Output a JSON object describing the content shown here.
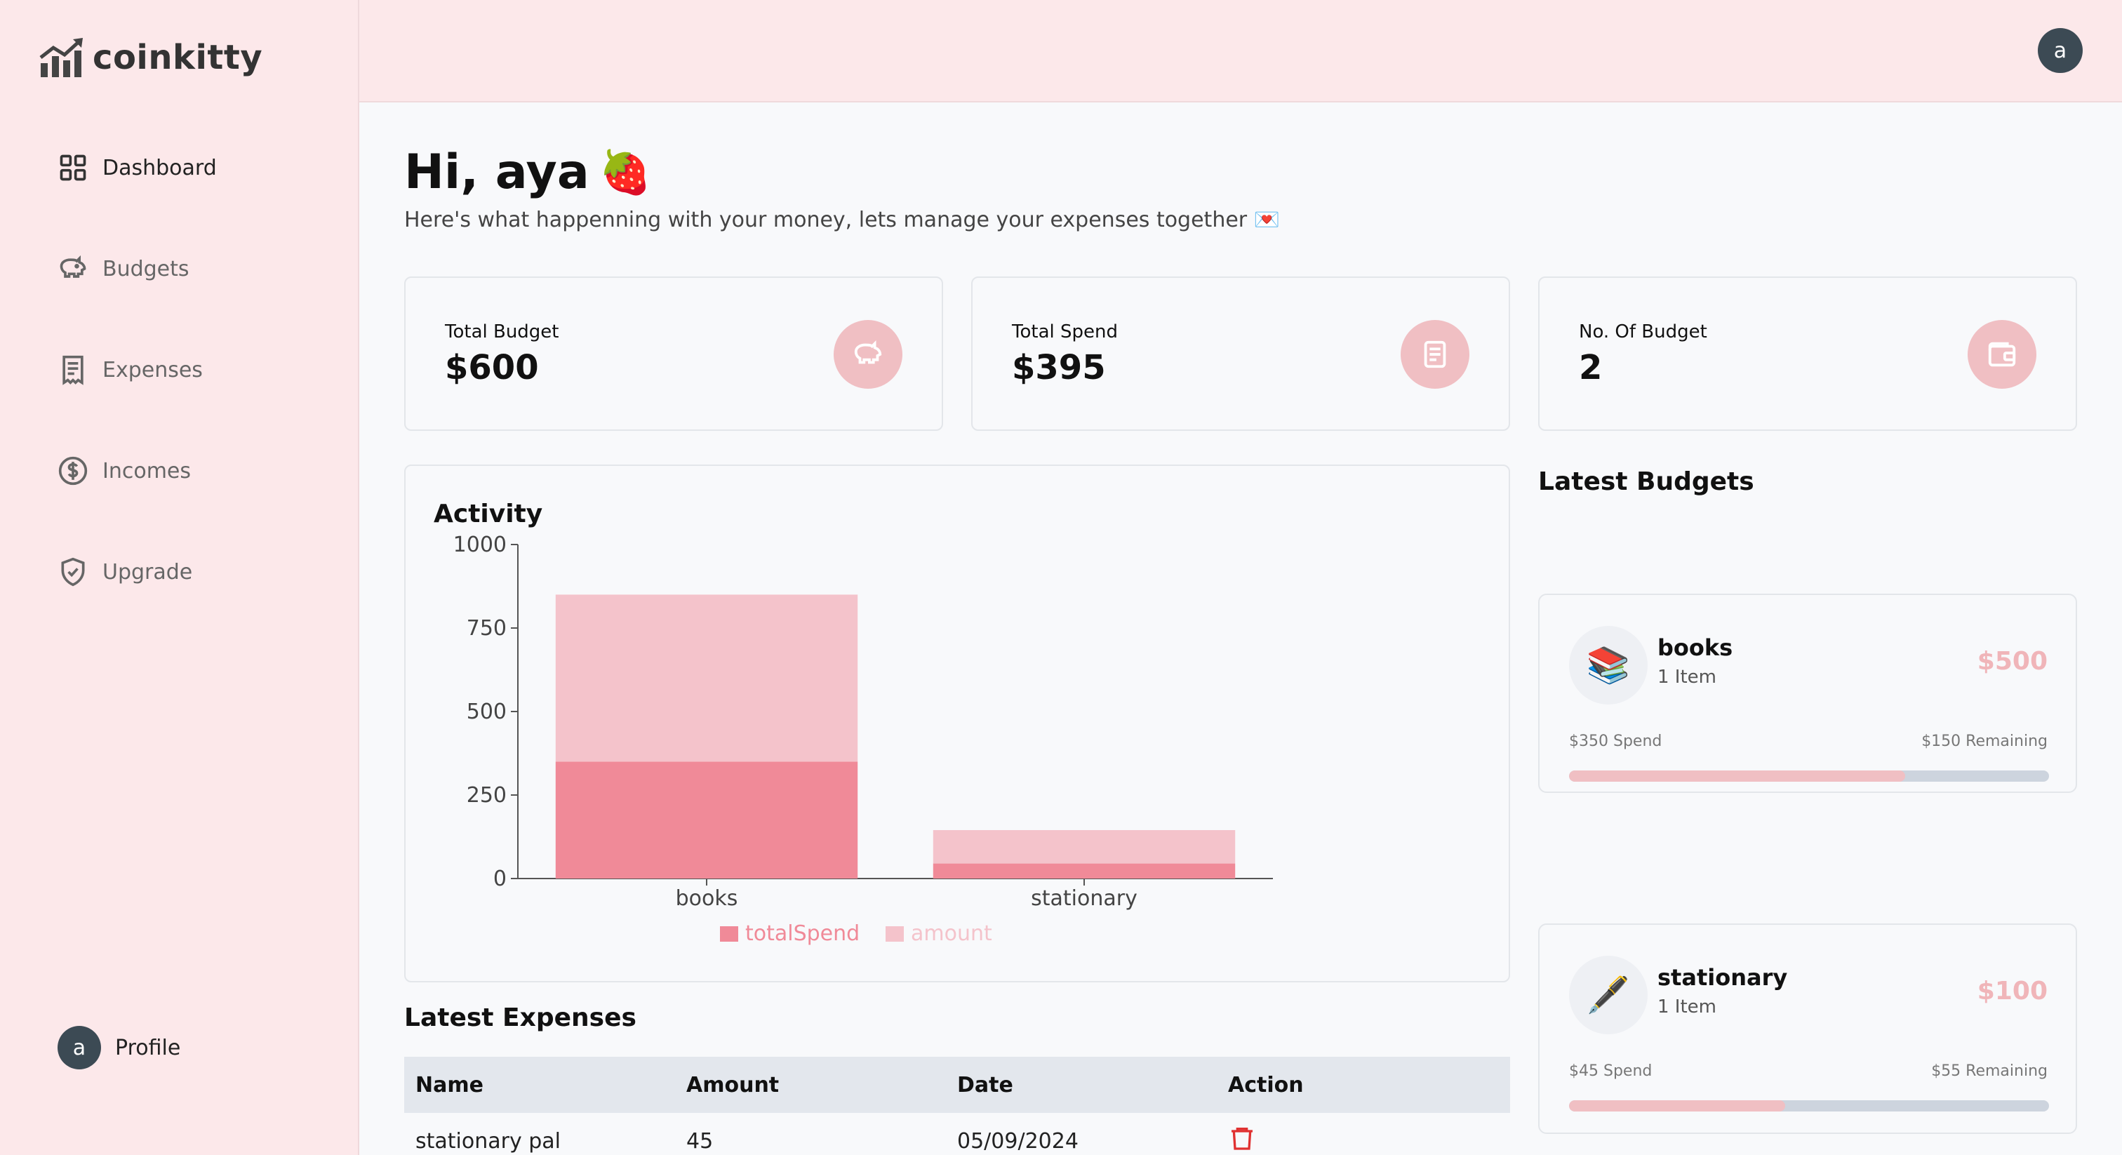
{
  "app": {
    "name": "coinkitty"
  },
  "sidebar": {
    "items": [
      {
        "label": "Dashboard",
        "icon": "dashboard-icon"
      },
      {
        "label": "Budgets",
        "icon": "piggy-bank-icon"
      },
      {
        "label": "Expenses",
        "icon": "receipt-icon"
      },
      {
        "label": "Incomes",
        "icon": "dollar-circle-icon"
      },
      {
        "label": "Upgrade",
        "icon": "shield-check-icon"
      }
    ],
    "profile": {
      "initial": "a",
      "label": "Profile"
    }
  },
  "header": {
    "avatar_initial": "a"
  },
  "greeting": {
    "title": "Hi, aya",
    "emoji": "🍓",
    "subtitle": "Here's what happenning with your money, lets manage your expenses together 💌"
  },
  "stats": [
    {
      "label": "Total Budget",
      "value": "$600",
      "icon": "piggy-bank-icon"
    },
    {
      "label": "Total Spend",
      "value": "$395",
      "icon": "receipt-icon"
    },
    {
      "label": "No. Of Budget",
      "value": "2",
      "icon": "wallet-icon"
    }
  ],
  "activity": {
    "title": "Activity"
  },
  "chart_data": {
    "type": "bar",
    "stacked": true,
    "categories": [
      "books",
      "stationary"
    ],
    "series": [
      {
        "name": "totalSpend",
        "values": [
          350,
          45
        ],
        "color": "#f08a98"
      },
      {
        "name": "amount",
        "values": [
          500,
          100
        ],
        "color": "#f4c3cb"
      }
    ],
    "yticks": [
      0,
      250,
      500,
      750,
      1000
    ],
    "ylim": [
      0,
      1000
    ],
    "legend": "bottom"
  },
  "latest_expenses": {
    "title": "Latest Expenses",
    "columns": [
      "Name",
      "Amount",
      "Date",
      "Action"
    ],
    "rows": [
      {
        "name": "stationary pal",
        "amount": "45",
        "date": "05/09/2024",
        "action_icon": "trash-icon"
      }
    ]
  },
  "latest_budgets": {
    "title": "Latest Budgets",
    "items": [
      {
        "emoji": "📚",
        "name": "books",
        "items": "1 Item",
        "amount": "$500",
        "spend": "$350 Spend",
        "remaining": "$150 Remaining",
        "progress": 0.7
      },
      {
        "emoji": "🖋️",
        "name": "stationary",
        "items": "1 Item",
        "amount": "$100",
        "spend": "$45 Spend",
        "remaining": "$55 Remaining",
        "progress": 0.45
      }
    ]
  }
}
